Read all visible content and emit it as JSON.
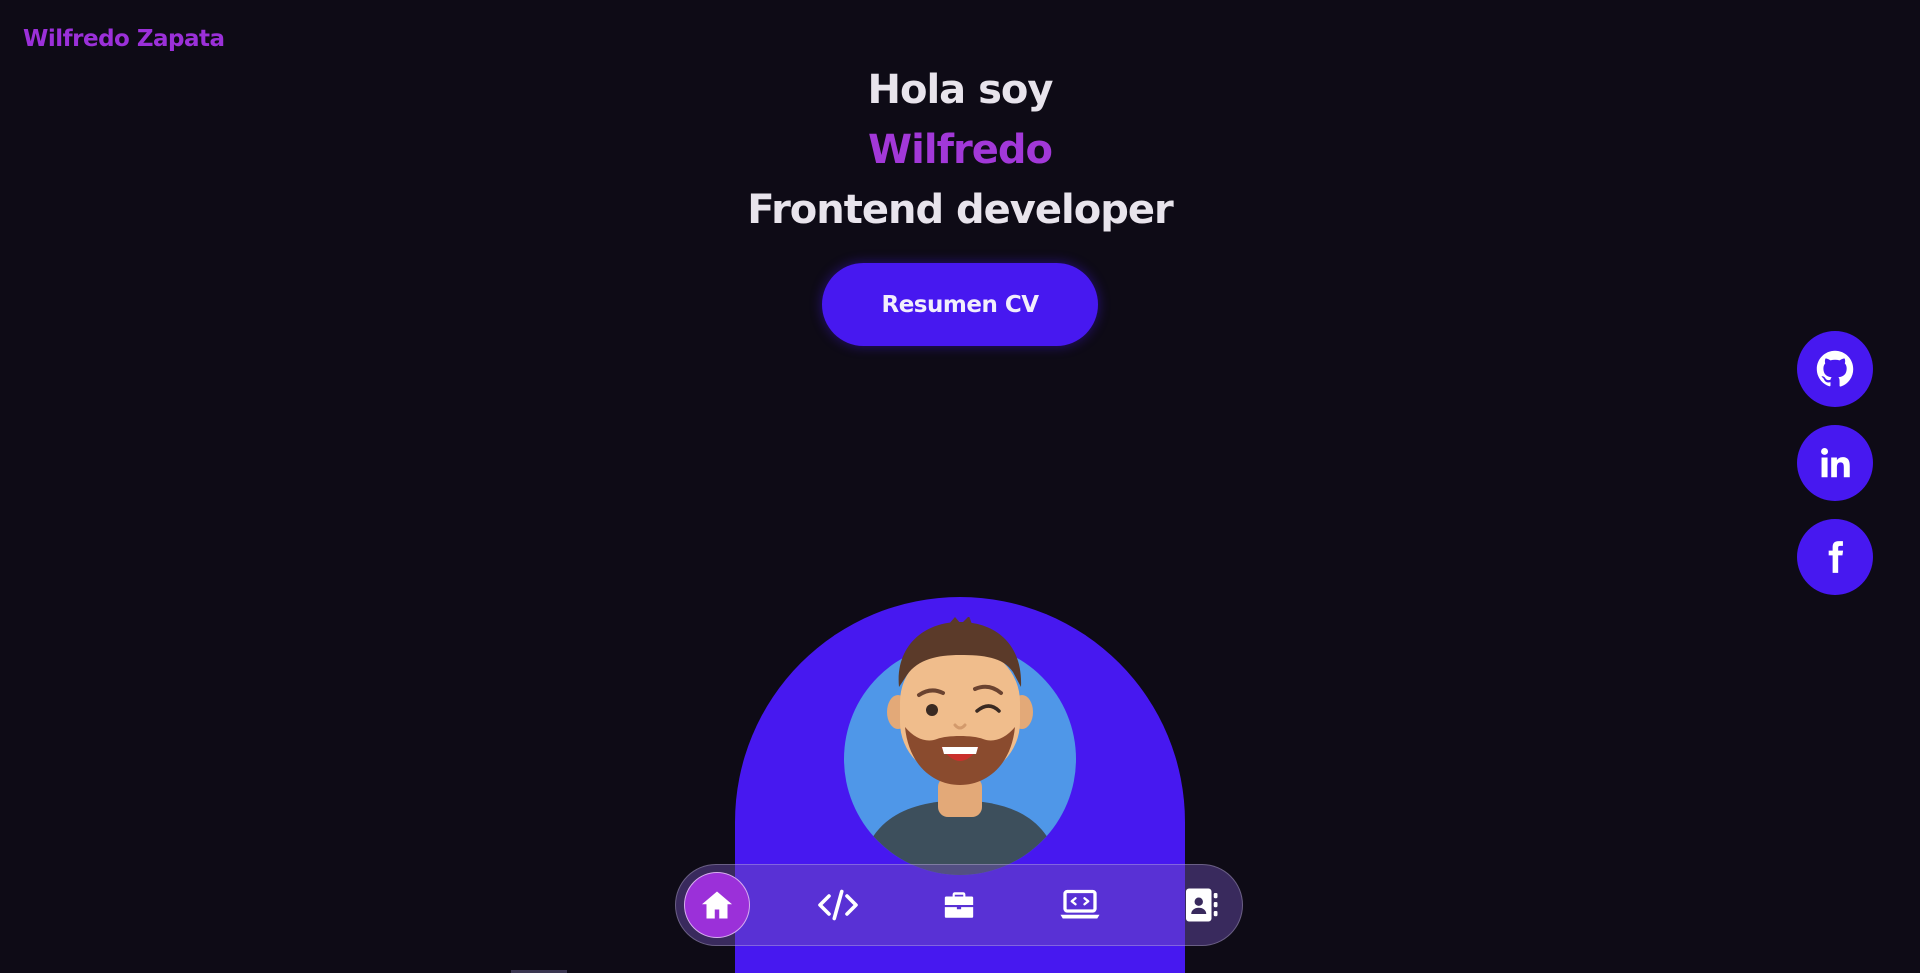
{
  "header": {
    "logo_text": "Wilfredo Zapata"
  },
  "hero": {
    "greeting": "Hola soy",
    "name": "Wilfredo",
    "role": "Frontend developer",
    "cv_button_label": "Resumen CV"
  },
  "social": [
    {
      "name": "github",
      "icon": "github-icon"
    },
    {
      "name": "linkedin",
      "icon": "linkedin-icon"
    },
    {
      "name": "facebook",
      "icon": "facebook-icon"
    }
  ],
  "nav": {
    "items": [
      {
        "name": "home",
        "icon": "home-icon",
        "active": true
      },
      {
        "name": "skills",
        "icon": "code-icon",
        "active": false
      },
      {
        "name": "experience",
        "icon": "briefcase-icon",
        "active": false
      },
      {
        "name": "projects",
        "icon": "laptop-code-icon",
        "active": false
      },
      {
        "name": "contact",
        "icon": "contact-book-icon",
        "active": false
      }
    ]
  },
  "colors": {
    "background": "#0e0b16",
    "primary": "#4718f0",
    "accent": "#9b30d9",
    "text": "#e8e4ec"
  }
}
